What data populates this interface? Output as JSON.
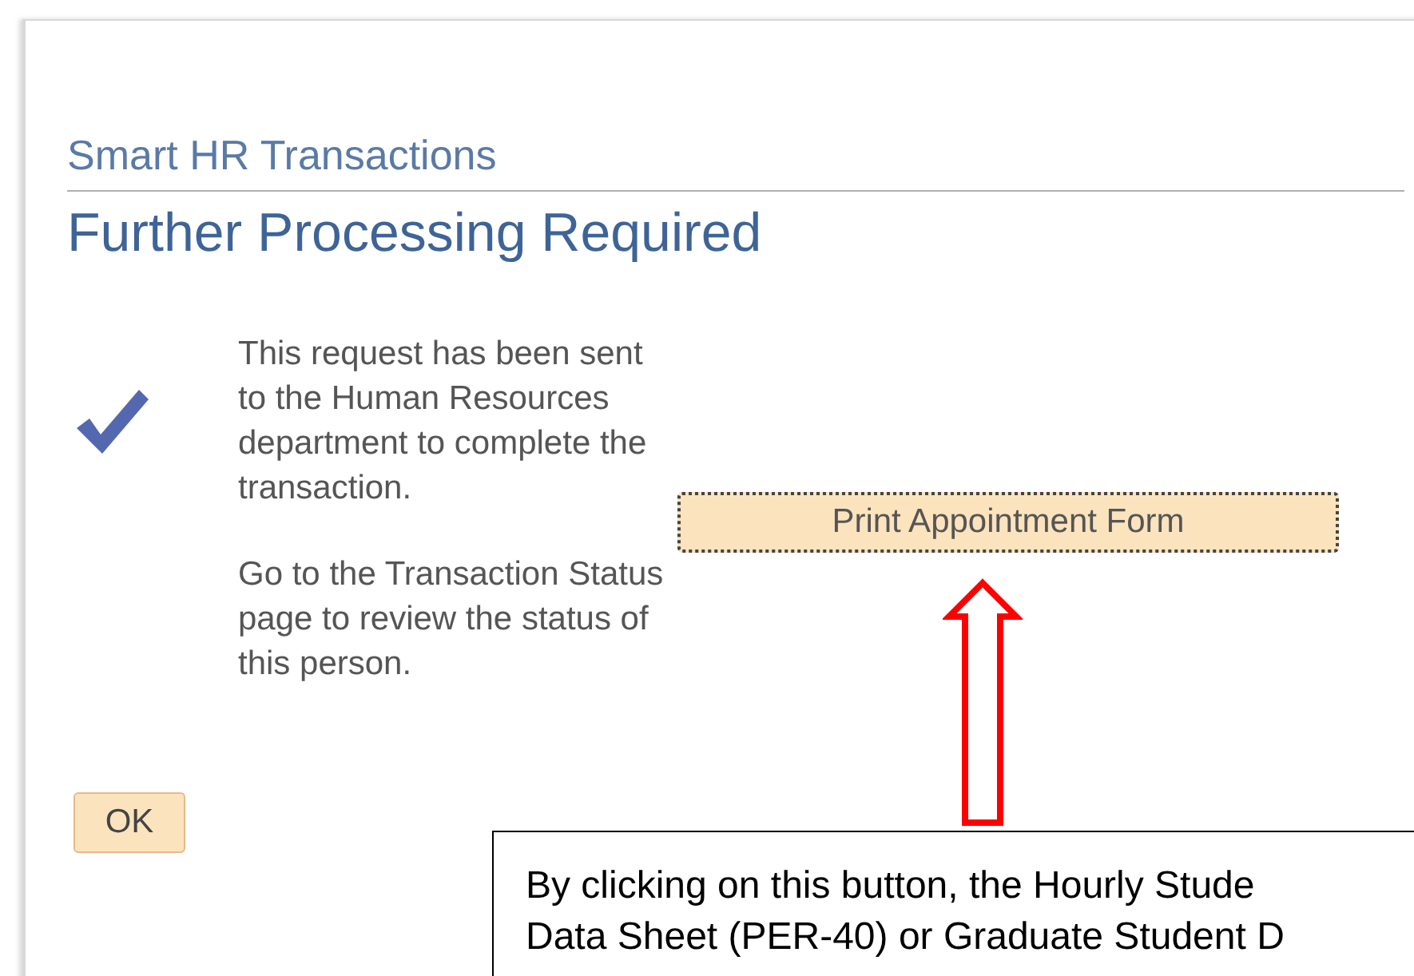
{
  "page": {
    "breadcrumb": "Smart HR Transactions",
    "title": "Further Processing Required"
  },
  "message": {
    "paragraphs": [
      "This request has been sent to the Human Resources department to complete the transaction.",
      "Go to the Transaction Status page to review the status of this person."
    ]
  },
  "print_button": {
    "label": "Print Appointment Form",
    "focused": true
  },
  "ok_button": {
    "label": "OK"
  },
  "callout": {
    "lines": [
      "By clicking on this button, the Hourly Stude",
      "Data Sheet (PER-40) or Graduate Student D"
    ]
  }
}
